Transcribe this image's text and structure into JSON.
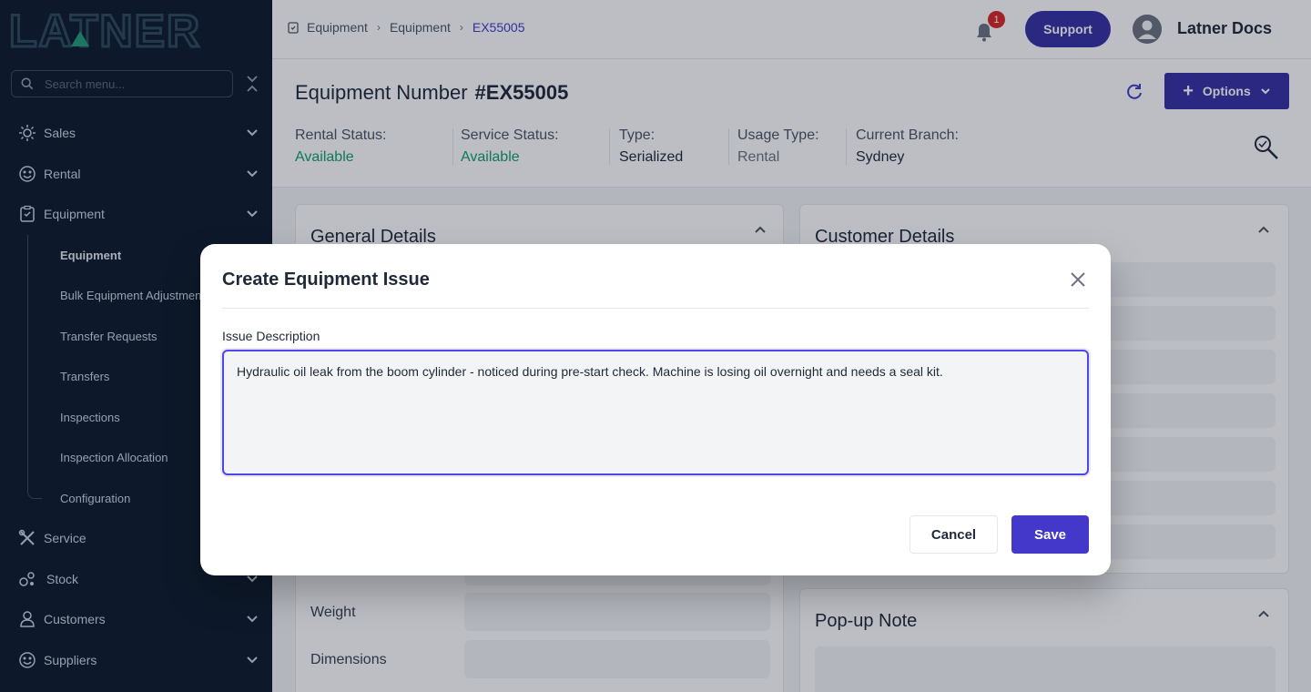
{
  "sidebar": {
    "logo_text": "LATNER",
    "search_placeholder": "Search menu...",
    "items": [
      {
        "label": "Sales",
        "icon": "sales-icon"
      },
      {
        "label": "Rental",
        "icon": "rental-icon"
      },
      {
        "label": "Equipment",
        "icon": "equipment-icon"
      },
      {
        "label": "Service",
        "icon": "service-icon"
      },
      {
        "label": "Stock",
        "icon": "stock-icon"
      },
      {
        "label": "Customers",
        "icon": "customers-icon"
      },
      {
        "label": "Suppliers",
        "icon": "suppliers-icon"
      }
    ],
    "sub_items": [
      {
        "label": "Equipment"
      },
      {
        "label": "Bulk Equipment Adjustments"
      },
      {
        "label": "Transfer Requests"
      },
      {
        "label": "Transfers"
      },
      {
        "label": "Inspections"
      },
      {
        "label": "Inspection Allocation"
      },
      {
        "label": "Configuration"
      }
    ]
  },
  "header": {
    "breadcrumb": [
      "Equipment",
      "Equipment",
      "EX55005"
    ],
    "notification_count": "1",
    "support_label": "Support",
    "user_name": "Latner Docs"
  },
  "equipment": {
    "title_label": "Equipment Number",
    "number": "#EX55005",
    "options_label": "Options",
    "statuses": [
      {
        "label": "Rental Status:",
        "value": "Available"
      },
      {
        "label": "Service Status:",
        "value": "Available"
      },
      {
        "label": "Type:",
        "value": "Serialized"
      },
      {
        "label": "Usage Type:",
        "value": "Rental"
      },
      {
        "label": "Current Branch:",
        "value": "Sydney"
      }
    ]
  },
  "cards": {
    "general_details": "General Details",
    "customer_details": "Customer Details",
    "popup_note": "Pop-up Note",
    "weight_label": "Weight",
    "dimensions_label": "Dimensions"
  },
  "modal": {
    "title": "Create Equipment Issue",
    "description_label": "Issue Description",
    "description_value": "Hydraulic oil leak from the boom cylinder - noticed during pre-start check. Machine is losing oil overnight and needs a seal kit.",
    "cancel_label": "Cancel",
    "save_label": "Save"
  },
  "colors": {
    "sidebar_bg": "#0d1b2a",
    "primary": "#3730a3",
    "status_green": "#0f9f6e"
  }
}
